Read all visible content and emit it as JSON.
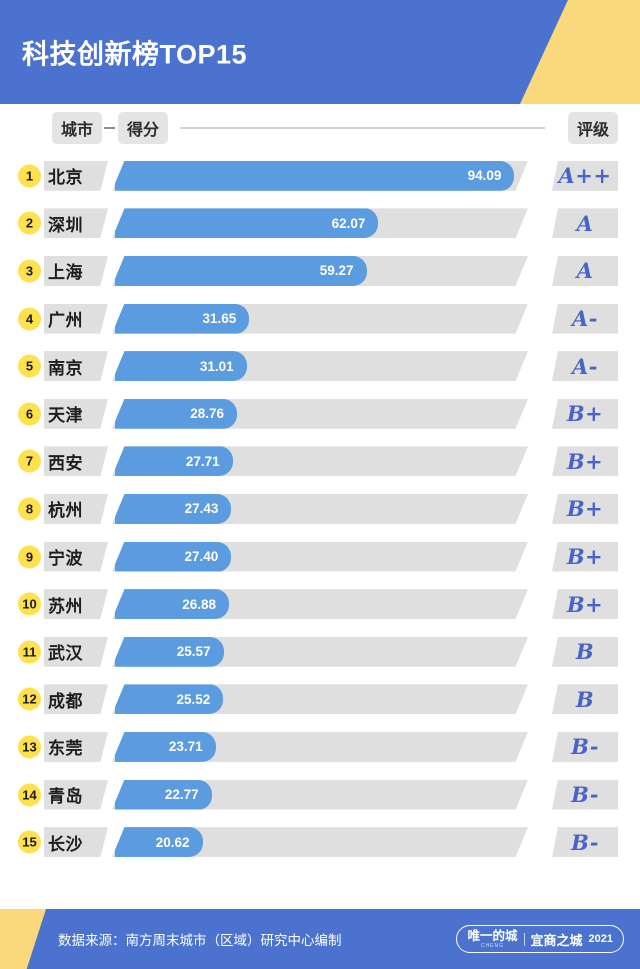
{
  "header": {
    "title": "科技创新榜TOP15",
    "brand_blue": "#4a72ce",
    "accent_yellow": "#f9d97b"
  },
  "columns": {
    "city": "城市",
    "score": "得分",
    "rating": "评级",
    "separator": "–"
  },
  "chart_data": {
    "type": "bar",
    "title": "科技创新榜TOP15",
    "xlabel": "得分",
    "ylabel": "城市",
    "orientation": "horizontal",
    "xlim": [
      0,
      100
    ],
    "grid": false,
    "legend": "none",
    "bar_color": "#5b9be0",
    "track_color": "#dfdfdf",
    "categories": [
      "北京",
      "深圳",
      "上海",
      "广州",
      "南京",
      "天津",
      "西安",
      "杭州",
      "宁波",
      "苏州",
      "武汉",
      "成都",
      "东莞",
      "青岛",
      "长沙"
    ],
    "values": [
      94.09,
      62.07,
      59.27,
      31.65,
      31.01,
      28.76,
      27.71,
      27.43,
      27.4,
      26.88,
      25.57,
      25.52,
      23.71,
      22.77,
      20.62
    ],
    "ratings": [
      "A++",
      "A",
      "A",
      "A-",
      "A-",
      "B+",
      "B+",
      "B+",
      "B+",
      "B+",
      "B",
      "B",
      "B-",
      "B-",
      "B-"
    ]
  },
  "rows": [
    {
      "rank": "1",
      "city": "北京",
      "value": "94.09",
      "pct": 94.09,
      "rating": "A++"
    },
    {
      "rank": "2",
      "city": "深圳",
      "value": "62.07",
      "pct": 62.07,
      "rating": "A"
    },
    {
      "rank": "3",
      "city": "上海",
      "value": "59.27",
      "pct": 59.27,
      "rating": "A"
    },
    {
      "rank": "4",
      "city": "广州",
      "value": "31.65",
      "pct": 31.65,
      "rating": "A-"
    },
    {
      "rank": "5",
      "city": "南京",
      "value": "31.01",
      "pct": 31.01,
      "rating": "A-"
    },
    {
      "rank": "6",
      "city": "天津",
      "value": "28.76",
      "pct": 28.76,
      "rating": "B+"
    },
    {
      "rank": "7",
      "city": "西安",
      "value": "27.71",
      "pct": 27.71,
      "rating": "B+"
    },
    {
      "rank": "8",
      "city": "杭州",
      "value": "27.43",
      "pct": 27.43,
      "rating": "B+"
    },
    {
      "rank": "9",
      "city": "宁波",
      "value": "27.40",
      "pct": 27.4,
      "rating": "B+"
    },
    {
      "rank": "10",
      "city": "苏州",
      "value": "26.88",
      "pct": 26.88,
      "rating": "B+"
    },
    {
      "rank": "11",
      "city": "武汉",
      "value": "25.57",
      "pct": 25.57,
      "rating": "B"
    },
    {
      "rank": "12",
      "city": "成都",
      "value": "25.52",
      "pct": 25.52,
      "rating": "B"
    },
    {
      "rank": "13",
      "city": "东莞",
      "value": "23.71",
      "pct": 23.71,
      "rating": "B-"
    },
    {
      "rank": "14",
      "city": "青岛",
      "value": "22.77",
      "pct": 22.77,
      "rating": "B-"
    },
    {
      "rank": "15",
      "city": "长沙",
      "value": "20.62",
      "pct": 20.62,
      "rating": "B-"
    }
  ],
  "footer": {
    "source": "数据来源：南方周末城市（区域）研究中心编制",
    "logo_left_main": "唯一的城",
    "logo_left_sub": "CHENG",
    "logo_right_main": "宜商之城",
    "logo_year": "2021"
  }
}
